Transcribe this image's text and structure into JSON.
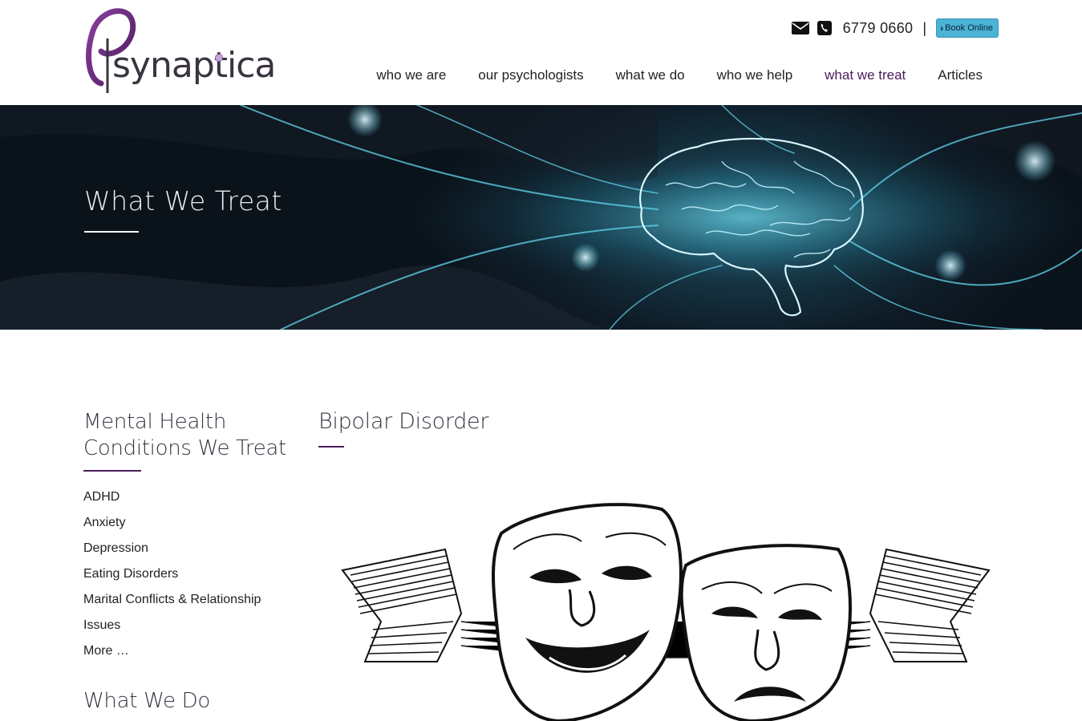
{
  "header": {
    "logo_text": "synaptica",
    "phone": "6779 0660",
    "separator": "|",
    "book_label": "Book Online",
    "nav": [
      {
        "label": "who we are"
      },
      {
        "label": "our psychologists"
      },
      {
        "label": "what we do"
      },
      {
        "label": "who we help"
      },
      {
        "label": "what we treat",
        "active": true
      },
      {
        "label": "Articles"
      }
    ]
  },
  "hero": {
    "title": "What We Treat"
  },
  "sidebar": {
    "heading": "Mental Health Conditions We Treat",
    "items": [
      {
        "label": "ADHD"
      },
      {
        "label": "Anxiety"
      },
      {
        "label": "Depression"
      },
      {
        "label": "Eating Disorders"
      },
      {
        "label": "Marital Conflicts & Relationship Issues"
      },
      {
        "label": "More …"
      }
    ],
    "heading_2": "What We Do"
  },
  "main": {
    "title": "Bipolar Disorder"
  },
  "colors": {
    "accent_purple": "#4b1d5e",
    "book_button": "#4ab3d6",
    "hero_glow": "#3fc6e0"
  },
  "icons": {
    "email": "envelope-icon",
    "phone": "phone-icon",
    "book": "chevron-right-icon"
  }
}
